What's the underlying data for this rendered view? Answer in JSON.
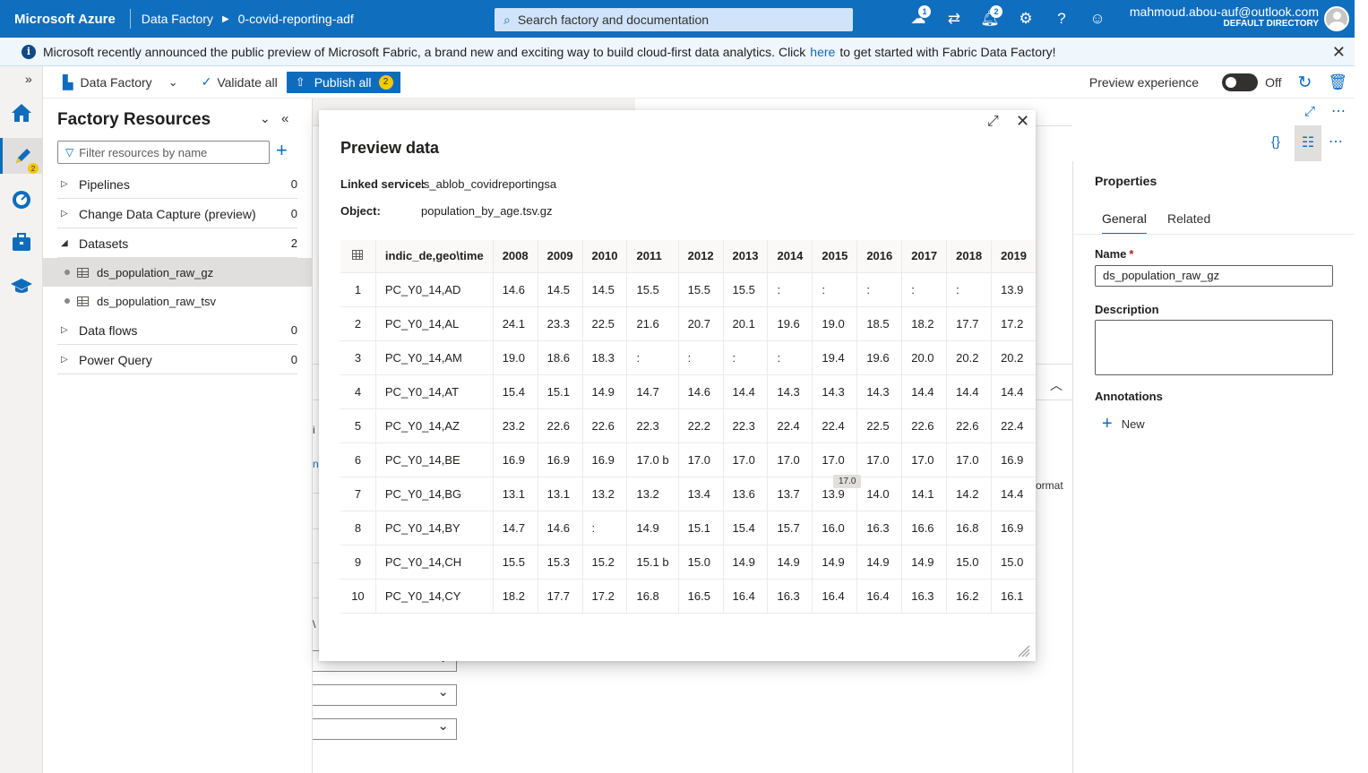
{
  "topbar": {
    "brand": "Microsoft Azure",
    "service": "Data Factory",
    "factory": "0-covid-reporting-adf",
    "search_placeholder": "Search factory and documentation",
    "notif_badge_1": "1",
    "notif_badge_2": "2",
    "user_email": "mahmoud.abou-auf@outlook.com",
    "user_directory": "DEFAULT DIRECTORY"
  },
  "banner": {
    "text_before": "Microsoft recently announced the public preview of Microsoft Fabric, a brand new and exciting way to build cloud-first data analytics. Click",
    "link": "here",
    "text_after": "to get started with Fabric Data Factory!"
  },
  "rail": {
    "author_badge": "2"
  },
  "toolbar": {
    "data_factory": "Data Factory",
    "validate_all": "Validate all",
    "publish_all": "Publish all",
    "publish_count": "2",
    "preview_experience": "Preview experience",
    "toggle_state": "Off"
  },
  "resources": {
    "title": "Factory Resources",
    "filter_placeholder": "Filter resources by name",
    "groups": [
      {
        "label": "Pipelines",
        "count": "0"
      },
      {
        "label": "Change Data Capture (preview)",
        "count": "0"
      },
      {
        "label": "Datasets",
        "count": "2"
      },
      {
        "label": "Data flows",
        "count": "0"
      },
      {
        "label": "Power Query",
        "count": "0"
      }
    ],
    "datasets": [
      "ds_population_raw_gz",
      "ds_population_raw_tsv"
    ]
  },
  "background": {
    "frag_1": "i",
    "frag_2": "n",
    "frag_3": "ormat",
    "frag_4": "\\"
  },
  "properties": {
    "title": "Properties",
    "tab_general": "General",
    "tab_related": "Related",
    "name_label": "Name",
    "name_required": "*",
    "name_value": "ds_population_raw_gz",
    "description_label": "Description",
    "annotations_label": "Annotations",
    "new_label": "New"
  },
  "preview": {
    "title": "Preview data",
    "linked_service_label": "Linked service:",
    "linked_service_value": "ls_ablob_covidreportingsa",
    "object_label": "Object:",
    "object_value": "population_by_age.tsv.gz",
    "columns": [
      "indic_de,geo\\time",
      "2008",
      "2009",
      "2010",
      "2011",
      "2012",
      "2013",
      "2014",
      "2015",
      "2016",
      "2017",
      "2018",
      "2019"
    ],
    "rows": [
      [
        "1",
        "PC_Y0_14,AD",
        "14.6",
        "14.5",
        "14.5",
        "15.5",
        "15.5",
        "15.5",
        ":",
        ":",
        ":",
        ":",
        ":",
        "13.9"
      ],
      [
        "2",
        "PC_Y0_14,AL",
        "24.1",
        "23.3",
        "22.5",
        "21.6",
        "20.7",
        "20.1",
        "19.6",
        "19.0",
        "18.5",
        "18.2",
        "17.7",
        "17.2"
      ],
      [
        "3",
        "PC_Y0_14,AM",
        "19.0",
        "18.6",
        "18.3",
        ":",
        ":",
        ":",
        ":",
        "19.4",
        "19.6",
        "20.0",
        "20.2",
        "20.2"
      ],
      [
        "4",
        "PC_Y0_14,AT",
        "15.4",
        "15.1",
        "14.9",
        "14.7",
        "14.6",
        "14.4",
        "14.3",
        "14.3",
        "14.3",
        "14.4",
        "14.4",
        "14.4"
      ],
      [
        "5",
        "PC_Y0_14,AZ",
        "23.2",
        "22.6",
        "22.6",
        "22.3",
        "22.2",
        "22.3",
        "22.4",
        "22.4",
        "22.5",
        "22.6",
        "22.6",
        "22.4"
      ],
      [
        "6",
        "PC_Y0_14,BE",
        "16.9",
        "16.9",
        "16.9",
        "17.0 b",
        "17.0",
        "17.0",
        "17.0",
        "17.0",
        "17.0",
        "17.0",
        "17.0",
        "16.9"
      ],
      [
        "7",
        "PC_Y0_14,BG",
        "13.1",
        "13.1",
        "13.2",
        "13.2",
        "13.4",
        "13.6",
        "13.7",
        "13.9",
        "14.0",
        "14.1",
        "14.2",
        "14.4"
      ],
      [
        "8",
        "PC_Y0_14,BY",
        "14.7",
        "14.6",
        ":",
        "14.9",
        "15.1",
        "15.4",
        "15.7",
        "16.0",
        "16.3",
        "16.6",
        "16.8",
        "16.9"
      ],
      [
        "9",
        "PC_Y0_14,CH",
        "15.5",
        "15.3",
        "15.2",
        "15.1 b",
        "15.0",
        "14.9",
        "14.9",
        "14.9",
        "14.9",
        "14.9",
        "15.0",
        "15.0"
      ],
      [
        "10",
        "PC_Y0_14,CY",
        "18.2",
        "17.7",
        "17.2",
        "16.8",
        "16.5",
        "16.4",
        "16.3",
        "16.4",
        "16.4",
        "16.3",
        "16.2",
        "16.1"
      ]
    ],
    "tooltip": "17.0"
  }
}
